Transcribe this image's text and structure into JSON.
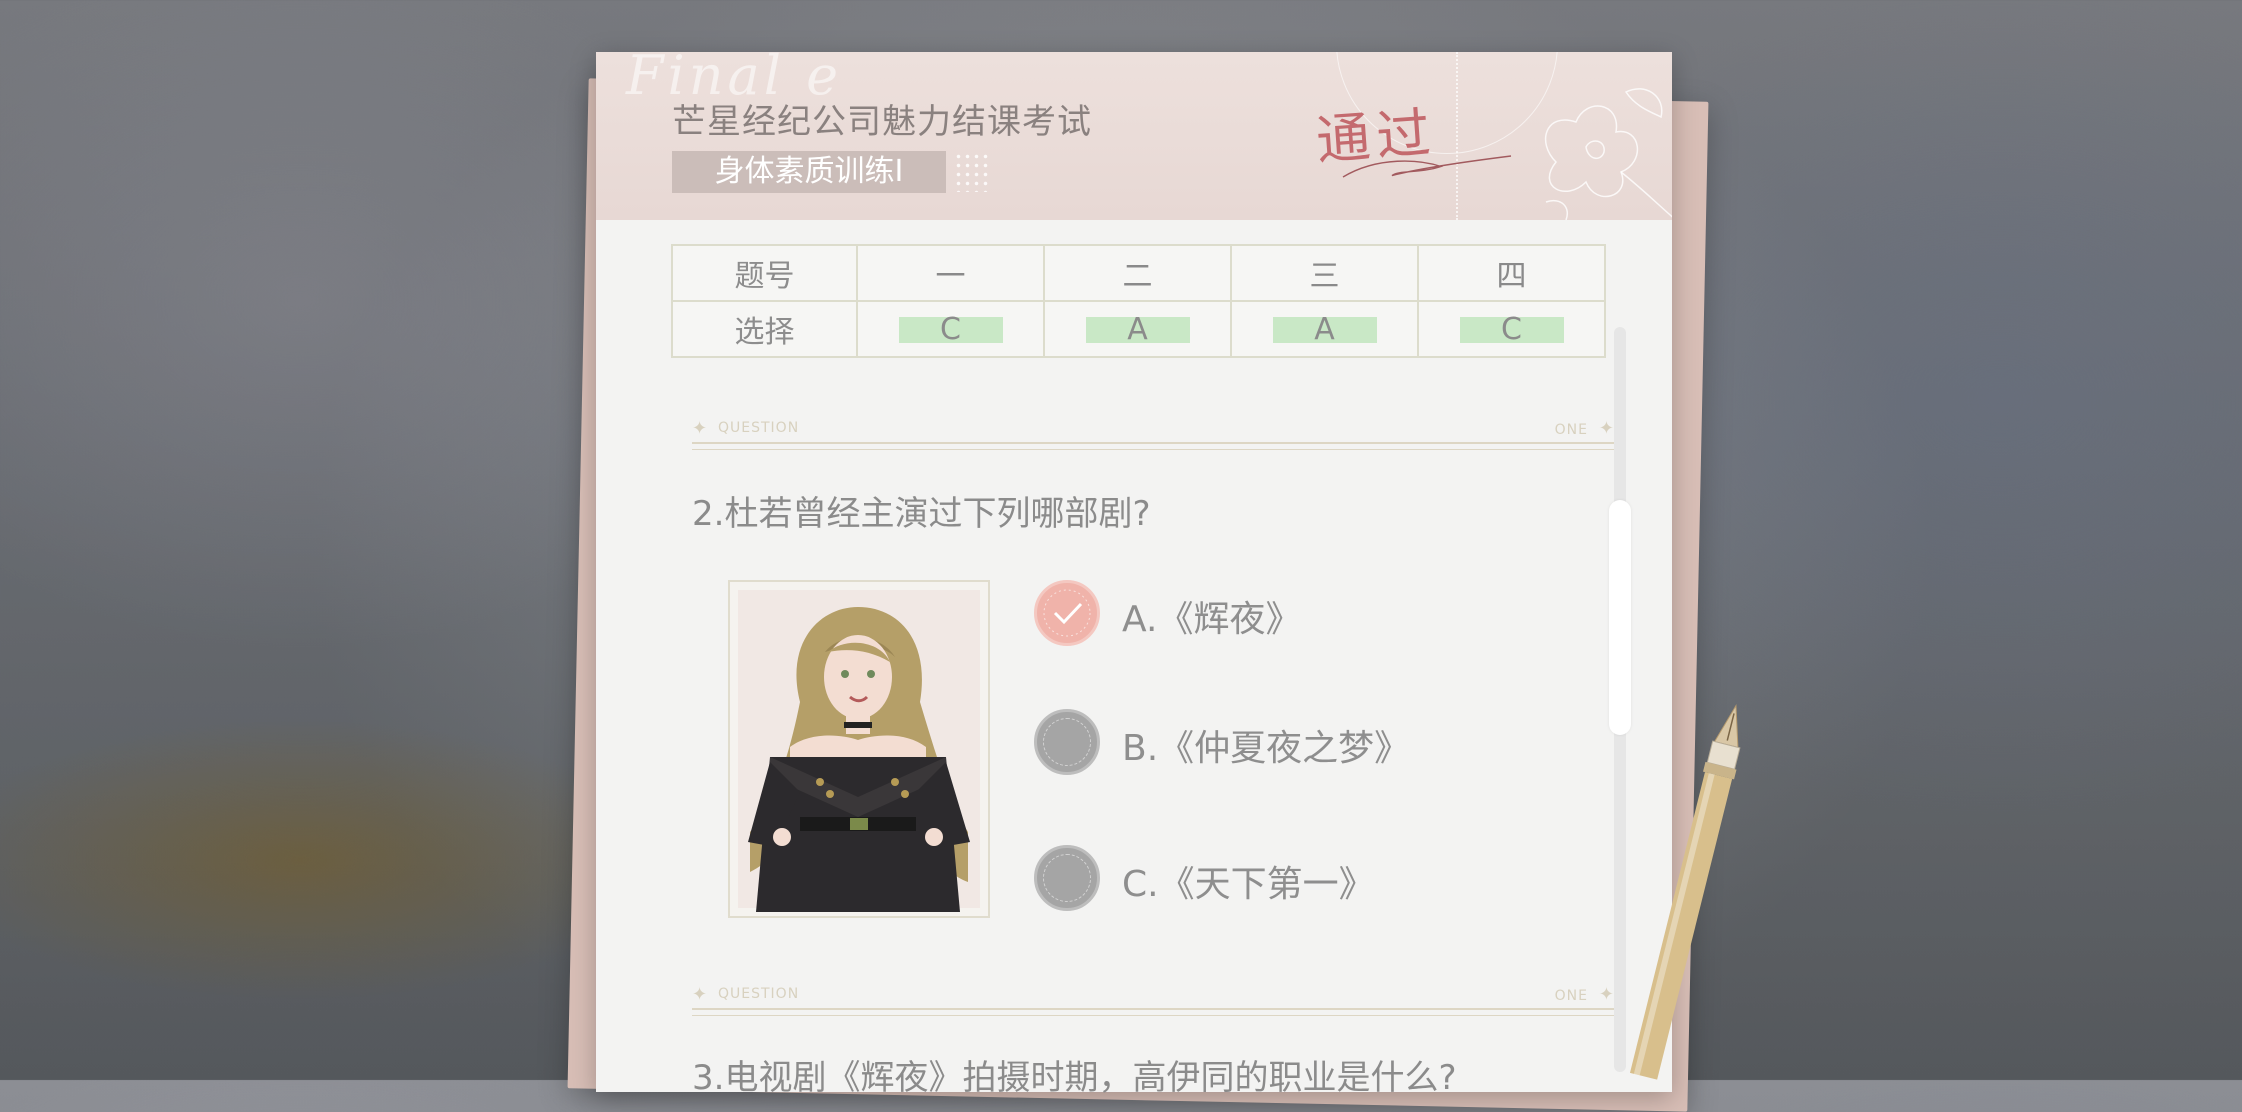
{
  "header": {
    "title": "芒星经纪公司魅力结课考试",
    "subject": "身体素质训练Ⅰ",
    "result_stamp": "通过",
    "decor_text": "Final e"
  },
  "answers": {
    "row_header_number": "题号",
    "row_header_choice": "选择",
    "numbers": [
      "一",
      "二",
      "三",
      "四"
    ],
    "choices": [
      "C",
      "A",
      "A",
      "C"
    ],
    "highlight_color": "#c9e8c6"
  },
  "dividers": {
    "left_label": "QUESTION",
    "right_label": "ONE"
  },
  "question2": {
    "text": "2.杜若曾经主演过下列哪部剧?",
    "options": [
      {
        "label": "A.《辉夜》",
        "selected": true
      },
      {
        "label": "B.《仲夏夜之梦》",
        "selected": false
      },
      {
        "label": "C.《天下第一》",
        "selected": false
      }
    ]
  },
  "question3": {
    "text": "3.电视剧《辉夜》拍摄时期，高伊同的职业是什么?"
  },
  "colors": {
    "selected_radio": "#f0b3aa",
    "unselected_radio": "#a5a5a5",
    "stamp": "#c46a6e"
  }
}
